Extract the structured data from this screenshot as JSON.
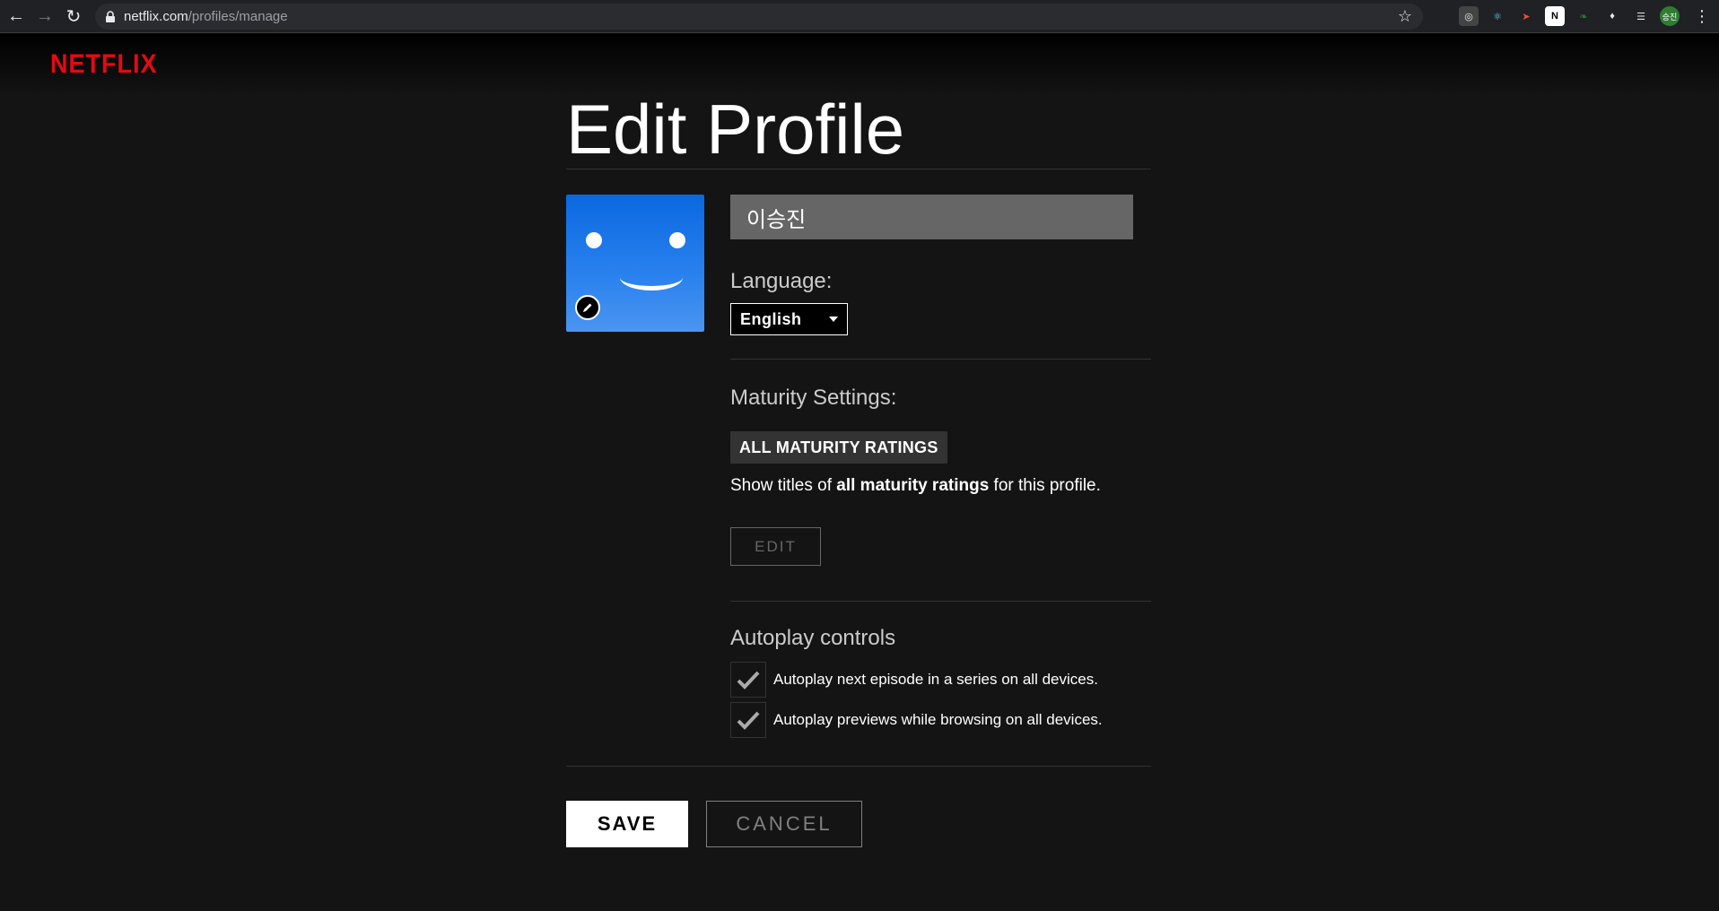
{
  "browser": {
    "url_host": "netflix.com",
    "url_path": "/profiles/manage",
    "profile_chip": "승진"
  },
  "brand": {
    "logo_text": "NETFLIX",
    "color": "#e50914"
  },
  "page": {
    "title": "Edit Profile",
    "profile_name": "이승진",
    "avatar_color": "#0a68e0",
    "language": {
      "label": "Language:",
      "selected": "English"
    },
    "maturity": {
      "label": "Maturity Settings:",
      "badge": "ALL MATURITY RATINGS",
      "desc_prefix": "Show titles of ",
      "desc_bold": "all maturity ratings",
      "desc_suffix": " for this profile.",
      "edit_label": "EDIT"
    },
    "autoplay": {
      "label": "Autoplay controls",
      "options": [
        {
          "text": "Autoplay next episode in a series on all devices.",
          "checked": true
        },
        {
          "text": "Autoplay previews while browsing on all devices.",
          "checked": true
        }
      ]
    },
    "save_label": "SAVE",
    "cancel_label": "CANCEL"
  }
}
